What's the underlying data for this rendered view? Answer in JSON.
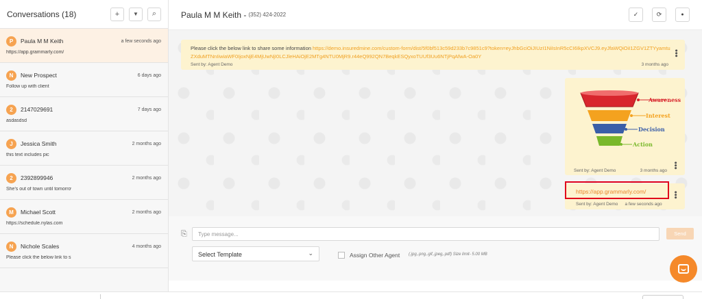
{
  "sidebar": {
    "title": "Conversations (18)",
    "buttons": {
      "add": "+",
      "filter": "▼",
      "search": "⌕"
    },
    "conversations": [
      {
        "initial": "P",
        "name": "Paula M M Keith",
        "time": "a few seconds ago",
        "preview": "https://app.grammarly.com/",
        "active": true
      },
      {
        "initial": "N",
        "name": "New Prospect",
        "time": "6 days ago",
        "preview": "Follow up with client"
      },
      {
        "initial": "2",
        "name": "2147029691",
        "time": "7 days ago",
        "preview": "asdasdsd"
      },
      {
        "initial": "J",
        "name": "Jessica Smith",
        "time": "2 months ago",
        "preview": "this text includes pic"
      },
      {
        "initial": "2",
        "name": "2392899946",
        "time": "2 months ago",
        "preview": "She's out of town until tomorrow"
      },
      {
        "initial": "M",
        "name": "Michael Scott",
        "time": "2 months ago",
        "preview": "https://schedule.nylas.com"
      },
      {
        "initial": "N",
        "name": "Nichole Scales",
        "time": "4 months ago",
        "preview": "Please click the below link to share"
      }
    ]
  },
  "header": {
    "contact_name": "Paula M M Keith",
    "contact_phone": "(352) 424-2022",
    "actions": {
      "resolve": "✓",
      "refresh": "⟳",
      "profile": "●"
    }
  },
  "messages": [
    {
      "text": "Please click the below link to share some information ",
      "link": "https://demo.insuredmine.com/custom-form/dist/5f0bf513c59d233b7c9851c9?token=eyJhbGciOiJIUzI1NiIsInR5cCI6IkpXVCJ9.eyJfaWQiOiI1ZGV1ZTYyamtuZXduMTNnIiwiaWF0IjoxNjE4MjUwNjI0LCJleHAiOjE2MTg4NTU0MjR9.r44eQ992QN7BeqkESQyxoTUUf3Uu6NTjPqAfwA-Oa0Y",
      "sent_by": "Sent by: Agent Demo",
      "time": "3 months ago"
    },
    {
      "image_labels": [
        "Awareness",
        "Interest",
        "Decision",
        "Action"
      ],
      "sent_by": "Sent by: Agent Demo",
      "time": "3 months ago"
    },
    {
      "link": "https://app.grammarly.com/",
      "sent_by": "Sent by: Agent Demo",
      "time": "a few seconds ago"
    }
  ],
  "composer": {
    "placeholder": "Type message...",
    "send_label": "Send",
    "template_label": "Select Template",
    "assign_label": "Assign Other Agent",
    "file_hint": "(.jpg,.png,.gif,.jpeg,.pdf) Size limit- 5.00 MB"
  },
  "colors": {
    "accent": "#f6a351",
    "link": "#f0a020",
    "bubble": "#fdf3cf",
    "highlight": "#e0001a"
  }
}
